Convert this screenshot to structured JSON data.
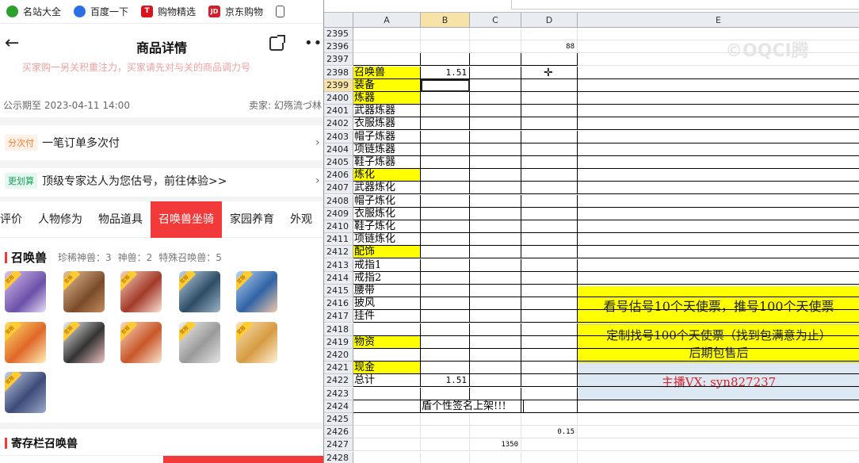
{
  "bookmarks": [
    {
      "label": "名站大全",
      "icon": "globe-icon"
    },
    {
      "label": "百度一下",
      "icon": "paw-icon"
    },
    {
      "label": "购物精选",
      "icon": "t-icon"
    },
    {
      "label": "京东购物",
      "icon": "jd-icon"
    }
  ],
  "jd_icon_text": "JD",
  "t_icon_text": "T",
  "nav": {
    "back": "←",
    "title": "商品详情",
    "more": "•••"
  },
  "notice_text": "买家购一另关积重注力，买家请先对与关的商品调力号",
  "publicity": "公示期至 2023-04-11 14:00",
  "seller": "卖家: 幻殇流づ林",
  "rows": [
    {
      "tag": "分次付",
      "text": "一笔订单多次付",
      "chev": "›"
    },
    {
      "tag": "更划算",
      "text": "顶级专家达人为您估号，前往体验>>",
      "chev": "›"
    }
  ],
  "tabs": [
    "评价",
    "人物修为",
    "物品道具",
    "召唤兽坐骑",
    "家园养育",
    "外观"
  ],
  "summon_section": {
    "title": "召唤兽",
    "stats": [
      "珍稀神兽：3",
      "神兽：2",
      "特殊召唤兽：5"
    ]
  },
  "storage_section": {
    "title": "寄存栏召唤兽"
  },
  "pet_badge": "官服",
  "sheet": {
    "columns": [
      "A",
      "B",
      "C",
      "D",
      "E"
    ],
    "rows": [
      "2395",
      "2396",
      "2397",
      "2398",
      "2399",
      "2400",
      "2401",
      "2402",
      "2403",
      "2404",
      "2405",
      "2406",
      "2407",
      "2408",
      "2409",
      "2410",
      "2411",
      "2412",
      "2413",
      "2414",
      "2415",
      "2416",
      "2417",
      "2418",
      "2419",
      "2420",
      "2421",
      "2422",
      "2423",
      "2424",
      "2425",
      "2426",
      "2427",
      "2428"
    ],
    "cells": {
      "D2396": "88",
      "A2398": "召唤兽",
      "B2398": "1.51",
      "A2399": "装备",
      "A2400": "炼器",
      "A2401": "武器炼器",
      "A2402": "衣服炼器",
      "A2403": "帽子炼器",
      "A2404": "项链炼器",
      "A2405": "鞋子炼器",
      "A2406": "炼化",
      "A2407": "武器炼化",
      "A2408": "帽子炼化",
      "A2409": "衣服炼化",
      "A2410": "鞋子炼化",
      "A2411": "项链炼化",
      "A2412": "配饰",
      "A2413": "戒指1",
      "A2414": "戒指2",
      "A2415": "腰带",
      "A2416": "披风",
      "A2417": "挂件",
      "A2419": "物资",
      "A2421": "现金",
      "A2422": "总计",
      "B2422": "1.51",
      "B2424": "盾个性签名上架!!!",
      "D2426": "0.15",
      "C2427": "1350"
    },
    "banner1": "看号估号10个天使票，推号100个天使票",
    "banner2_line1": "定制找号100个天使票（找到包满意为止）",
    "banner2_line2": "后期包售后",
    "banner3": "主播VX: syn827237",
    "watermark": "©OQCI腾"
  }
}
